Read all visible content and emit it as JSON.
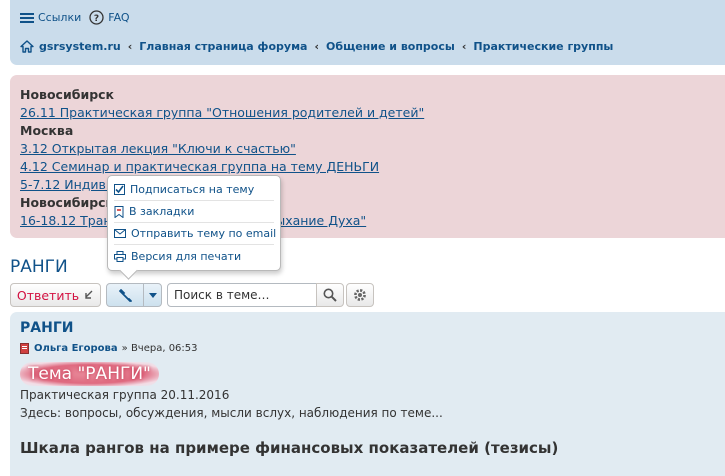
{
  "nav": {
    "links": [
      "Ссылки",
      "FAQ"
    ],
    "breadcrumbs": [
      "gsrsystem.ru",
      "Главная страница форума",
      "Общение и вопросы",
      "Практические группы"
    ]
  },
  "notice": {
    "lines": [
      {
        "type": "city",
        "text": "Новосибирск"
      },
      {
        "type": "event",
        "text": "26.11 Практическая группа \"Отношения родителей и детей\""
      },
      {
        "type": "city",
        "text": "Москва"
      },
      {
        "type": "event",
        "text": "3.12 Открытая лекция \"Ключи к счастью\""
      },
      {
        "type": "event",
        "text": "4.12 Семинар и практическая группа на тему ДЕНЬГИ"
      },
      {
        "type": "event",
        "text": "5-7.12 Индиви"
      },
      {
        "type": "city",
        "text": "Новосибирск"
      },
      {
        "type": "event",
        "text": "16-18.12 Тран"
      }
    ],
    "hidden_tail": "Дыхание Духа\""
  },
  "topic": {
    "title": "РАНГИ"
  },
  "toolbar": {
    "reply_label": "Ответить",
    "search_placeholder": "Поиск в теме…"
  },
  "tools_menu": {
    "items": [
      "Подписаться на тему",
      "В закладки",
      "Отправить тему по email",
      "Версия для печати"
    ]
  },
  "post": {
    "title": "РАНГИ",
    "author": "Ольга Егорова",
    "time": "» Вчера, 06:53",
    "heading": "Тема \"РАНГИ\"",
    "line1": "Практическая группа 20.11.2016",
    "line2": "Здесь: вопросы, обсуждения, мысли вслух, наблюдения по теме...",
    "subheading": "Шкала рангов на примере финансовых показателей (тезисы)"
  },
  "colors": {
    "link": "#105289",
    "navbar": "#cadceb",
    "notice": "#ecd5d8",
    "post": "#e1ebf2",
    "reply": "#d31141"
  }
}
